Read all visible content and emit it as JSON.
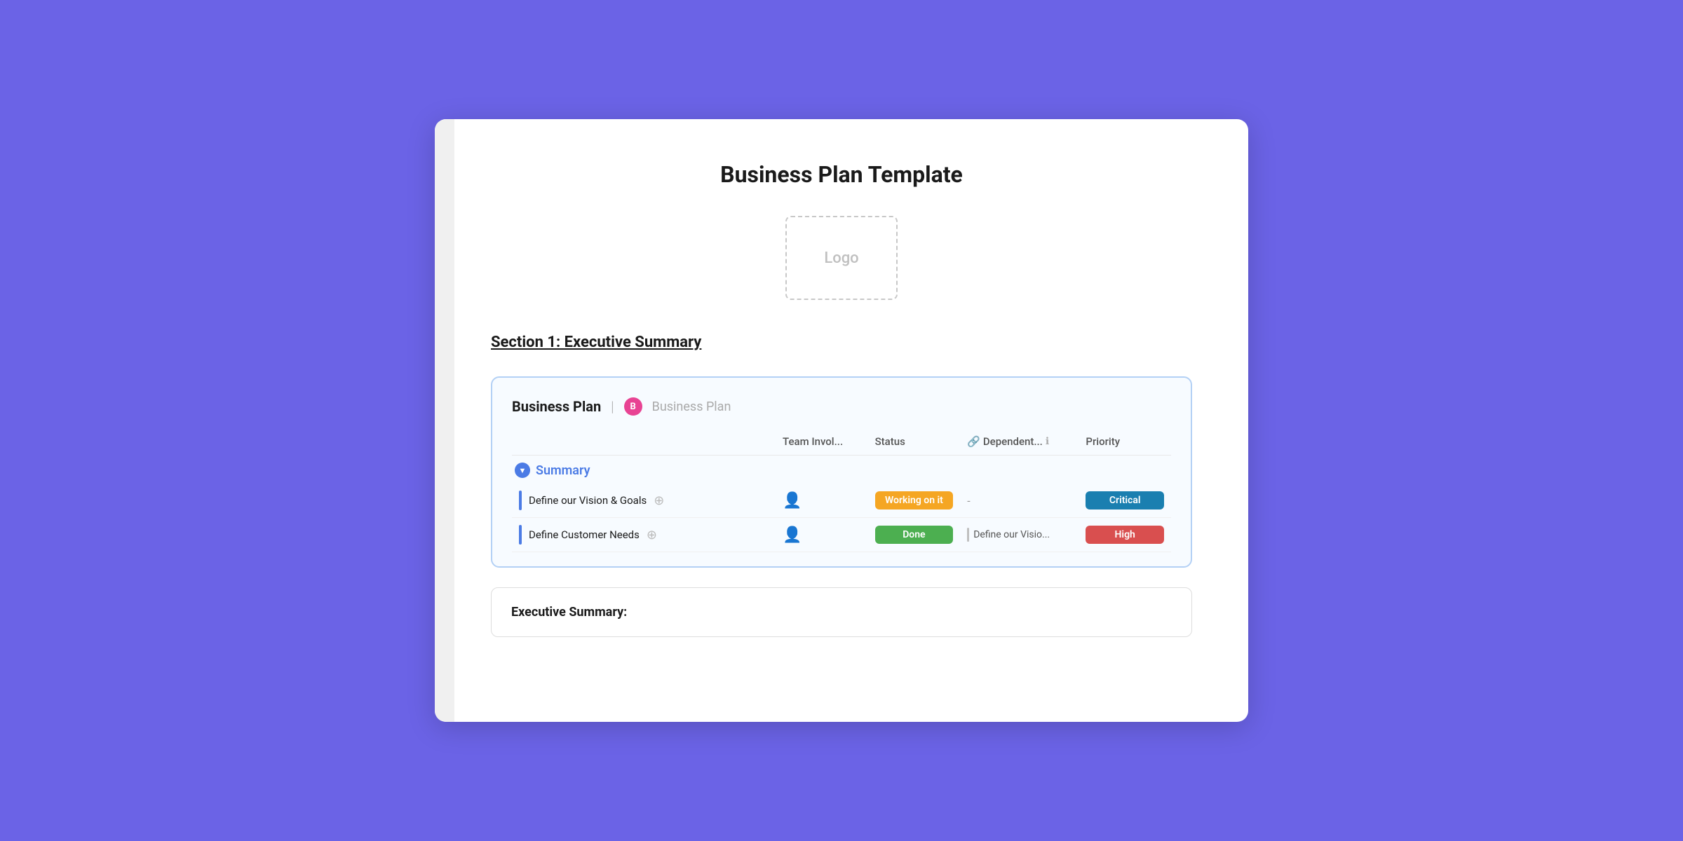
{
  "document": {
    "title": "Business Plan Template",
    "logo_placeholder": "Logo",
    "section_heading": "Section 1: Executive Summary"
  },
  "task_board": {
    "board_title": "Business Plan",
    "board_badge_letter": "B",
    "board_project_name": "Business Plan",
    "columns": {
      "task": "",
      "team": "Team Invol...",
      "status": "Status",
      "dep_icon": "🔗",
      "dep": "Dependent...",
      "priority": "Priority"
    },
    "summary_section": {
      "label": "Summary",
      "tasks": [
        {
          "name": "Define our Vision & Goals",
          "status_label": "Working on it",
          "status_class": "status-working",
          "dependency": "-",
          "dep_has_bar": false,
          "priority_label": "Critical",
          "priority_class": "priority-critical"
        },
        {
          "name": "Define Customer Needs",
          "status_label": "Done",
          "status_class": "status-done",
          "dependency": "Define our Visio...",
          "dep_has_bar": true,
          "priority_label": "High",
          "priority_class": "priority-high"
        }
      ]
    }
  },
  "exec_summary_card": {
    "title": "Executive Summary:"
  }
}
